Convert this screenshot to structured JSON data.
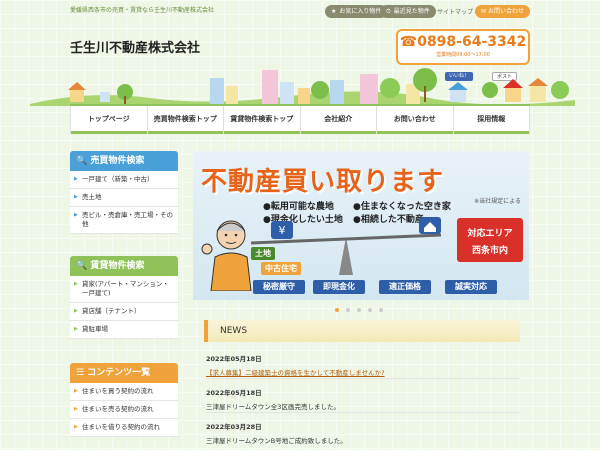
{
  "header": {
    "tagline": "愛媛県西条市の売買・賃貸なら壬生川不動産株式会社",
    "favorites_label": "お気に入り物件",
    "recent_label": "最近見た物件",
    "sitemap_label": "サイトマップ",
    "contact_label": "お問い合わせ",
    "company_name": "壬生川不動産株式会社",
    "phone": "0898-64-3342",
    "hours": "営業時間09:00～17:00",
    "like_label": "いいね！",
    "post_label": "ポスト"
  },
  "nav": {
    "items": [
      "トップページ",
      "売買物件検索トップ",
      "賃貸物件検索トップ",
      "会社紹介",
      "お問い合わせ",
      "採用情報"
    ]
  },
  "sidebar": {
    "sale_title": "売買物件検索",
    "sale_items": [
      "一戸建て（新築・中古）",
      "売土地",
      "売ビル・売倉庫・売工場・その他"
    ],
    "rent_title": "賃貸物件検索",
    "rent_items": [
      "貸家(アパート・マンション・一戸建て)",
      "貸店舗（テナント）",
      "貸駐車場"
    ],
    "contents_title": "コンテンツ一覧",
    "contents_items": [
      "住まいを買う契約の流れ",
      "住まいを売る契約の流れ",
      "住まいを借りる契約の流れ"
    ]
  },
  "banner": {
    "title": "不動産買い取ります",
    "note": "※当社規定による",
    "points": [
      "●転用可能な農地",
      "●住まなくなった空き家",
      "●現金化したい土地",
      "●相続した不動産"
    ],
    "land_label": "土地",
    "house_label": "中古住宅",
    "area_label": "対応エリア",
    "area_name": "西条市内",
    "features": [
      "秘密厳守",
      "即現金化",
      "適正価格",
      "誠実対応"
    ]
  },
  "news": {
    "title": "NEWS",
    "items": [
      {
        "date": "2022年05月18日",
        "text": "【求人募集】二級建築士の資格を生かして不動産しませんか?",
        "link": true
      },
      {
        "date": "2022年05月18日",
        "text": "三津屋ドリームタウン全3区画完売しました。",
        "link": false
      },
      {
        "date": "2022年03月28日",
        "text": "三津屋ドリームタウンB号地ご成約致しました。",
        "link": false
      }
    ]
  },
  "colors": {
    "accent_orange": "#f0a33a",
    "nav_green": "#8fc35a",
    "sale_blue": "#4aa0d8",
    "rent_lime": "#8fc35a",
    "banner_red": "#e8631a",
    "feature_blue": "#2f5ea8"
  },
  "icons": [
    "star-icon",
    "clock-icon",
    "mail-icon",
    "phone-icon",
    "search-icon",
    "list-icon",
    "yen-icon",
    "house-icon"
  ]
}
